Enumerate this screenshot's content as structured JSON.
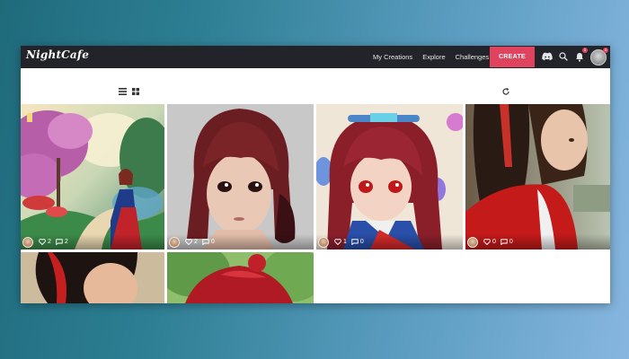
{
  "app": {
    "logo_text": "NightCafe"
  },
  "nav": {
    "links": [
      "My Creations",
      "Explore",
      "Challenges"
    ],
    "create_label": "CREATE",
    "notification_count": "1",
    "profile_badge": "1"
  },
  "toolbar": {
    "icons": [
      "list-view-icon",
      "grid-view-icon",
      "refresh-icon"
    ]
  },
  "gallery": {
    "items": [
      {
        "likes": "2",
        "comments": "2"
      },
      {
        "likes": "2",
        "comments": "0"
      },
      {
        "likes": "1",
        "comments": "0"
      },
      {
        "likes": "0",
        "comments": "0"
      }
    ]
  },
  "colors": {
    "accent": "#e0435e",
    "navbar": "#22242a",
    "background_start": "#1f6b7c",
    "background_end": "#87b6e0"
  }
}
